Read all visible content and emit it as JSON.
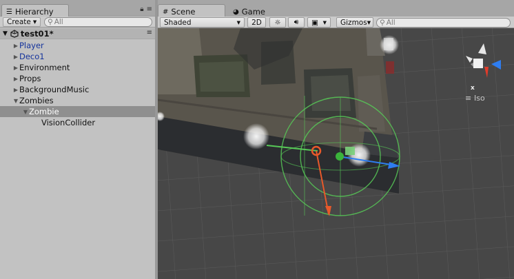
{
  "hierarchy": {
    "tab_label": "Hierarchy",
    "create_label": "Create",
    "search_placeholder": "All",
    "scene_name": "test01*",
    "items": [
      {
        "label": "Player",
        "prefab": true,
        "depth": 0,
        "expand": "collapsed"
      },
      {
        "label": "Deco1",
        "prefab": true,
        "depth": 0,
        "expand": "collapsed"
      },
      {
        "label": "Environment",
        "prefab": false,
        "depth": 0,
        "expand": "collapsed"
      },
      {
        "label": "Props",
        "prefab": false,
        "depth": 0,
        "expand": "collapsed"
      },
      {
        "label": "BackgroundMusic",
        "prefab": false,
        "depth": 0,
        "expand": "collapsed"
      },
      {
        "label": "Zombies",
        "prefab": false,
        "depth": 0,
        "expand": "expanded"
      },
      {
        "label": "Zombie",
        "prefab": false,
        "depth": 1,
        "expand": "expanded",
        "selected": true
      },
      {
        "label": "VisionCollider",
        "prefab": false,
        "depth": 2,
        "expand": "none"
      }
    ]
  },
  "scene": {
    "tabs": [
      {
        "label": "Scene",
        "active": true
      },
      {
        "label": "Game",
        "active": false
      }
    ],
    "shading_mode": "Shaded",
    "mode_2d_label": "2D",
    "gizmos_label": "Gizmos",
    "search_placeholder": "All",
    "projection_label": "Iso",
    "gizmo_axis_label": "x"
  },
  "colors": {
    "accent_selection": "#8f8f8f",
    "prefab_text": "#14339c",
    "viewport_bg": "#474747",
    "wire_sphere": "#57c957",
    "axis_x": "#e8592a",
    "axis_z": "#2e7df0"
  }
}
